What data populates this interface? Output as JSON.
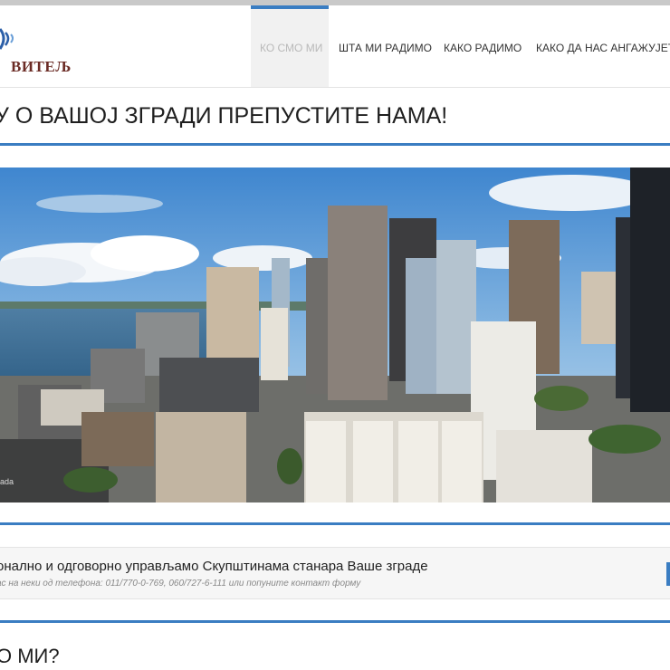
{
  "header": {
    "logo_text": "ВИТЕЉ",
    "nav": [
      {
        "label": "КО СМО МИ",
        "active": true
      },
      {
        "label": "ШТА МИ РАДИМО",
        "active": false
      },
      {
        "label": "КАКО РАДИМО",
        "active": false
      },
      {
        "label": "КАКО ДА НАС АНГАЖУЈЕТЕ",
        "active": false
      }
    ]
  },
  "hero": {
    "title": "У О ВАШОЈ ЗГРАДИ ПРЕПУСТИТЕ НАМА!",
    "image_caption": "ada"
  },
  "callout": {
    "title": "онално и одговорно управљамо Скупштинама станара Ваше зграде",
    "subtitle": "ас на неки од телефона: 011/770-0-769, 060/727-6-111 или попуните контакт форму"
  },
  "about": {
    "title": "О МИ?"
  },
  "colors": {
    "accent": "#3a7dc2",
    "logo": "#6b2b25",
    "sky": "#4a8fd0"
  }
}
